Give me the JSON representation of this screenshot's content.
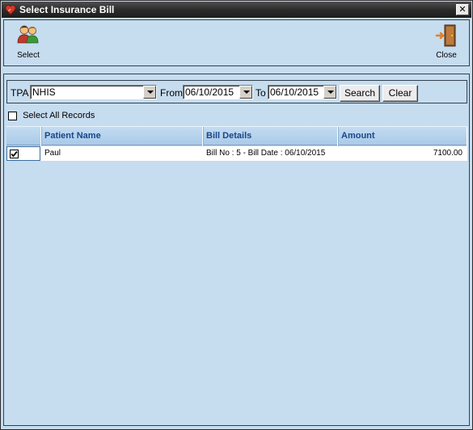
{
  "window": {
    "title": "Select Insurance Bill",
    "close_glyph": "✕"
  },
  "toolbar": {
    "select_label": "Select",
    "close_label": "Close"
  },
  "filter": {
    "tpa_label": "TPA",
    "tpa_value": "NHIS",
    "from_label": "From",
    "from_value": "06/10/2015",
    "to_label": "To",
    "to_value": "06/10/2015",
    "search_label": "Search",
    "clear_label": "Clear"
  },
  "select_all": {
    "label": "Select All Records",
    "checked": false
  },
  "table": {
    "columns": [
      "Patient Name",
      "Bill Details",
      "Amount"
    ],
    "rows": [
      {
        "checked": true,
        "patient_name": "Paul",
        "bill_details": "Bill No : 5 - Bill Date : 06/10/2015",
        "amount": "7100.00"
      }
    ]
  },
  "colors": {
    "background": "#c6dcef",
    "header_text": "#17478a",
    "titlebar": "#2c2c2c"
  },
  "icons": {
    "app": "heart-icon",
    "select": "users-icon",
    "close": "exit-door-icon"
  }
}
